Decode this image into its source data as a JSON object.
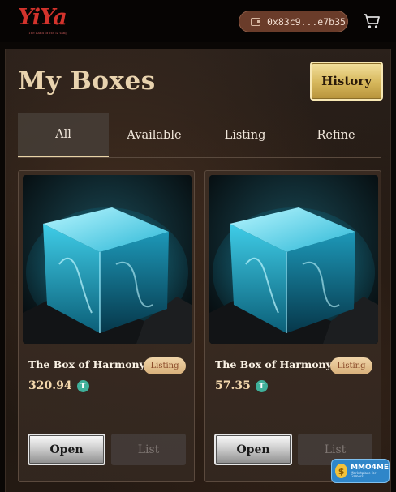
{
  "header": {
    "logo_text": "YiYa",
    "logo_tagline": "The Land of Yin & Yang",
    "wallet_address": "0x83c9...e7b35",
    "wallet_icon": "wallet-icon",
    "cart_icon": "cart-icon"
  },
  "page": {
    "title": "My Boxes",
    "history_label": "History"
  },
  "tabs": [
    {
      "label": "All",
      "active": true
    },
    {
      "label": "Available",
      "active": false
    },
    {
      "label": "Listing",
      "active": false
    },
    {
      "label": "Refine",
      "active": false
    }
  ],
  "cards": [
    {
      "name": "The Box of Harmony",
      "badge": "Listing",
      "price": "320.94",
      "currency_icon": "tether-icon",
      "currency_symbol": "T",
      "open_label": "Open",
      "list_label": "List"
    },
    {
      "name": "The Box of Harmony",
      "badge": "Listing",
      "price": "57.35",
      "currency_icon": "tether-icon",
      "currency_symbol": "T",
      "open_label": "Open",
      "list_label": "List"
    }
  ],
  "watermark": {
    "text": "MMO4ME",
    "sub": "Marketplace for Gamers",
    "coin_symbol": "$"
  },
  "colors": {
    "accent_gold": "#d6b75b",
    "title": "#e9d3ae",
    "logo_red": "#d3332c",
    "badge": "#e4c08c"
  }
}
